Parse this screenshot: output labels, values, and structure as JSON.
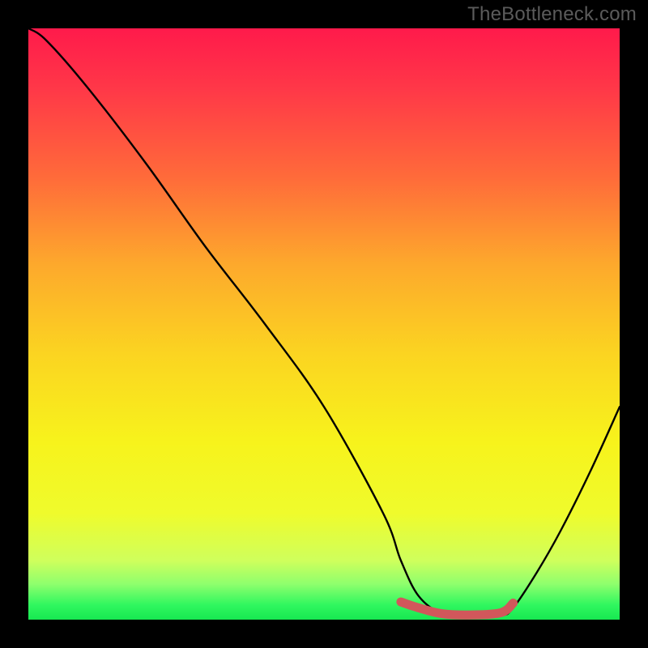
{
  "watermark": "TheBottleneck.com",
  "chart_data": {
    "type": "line",
    "title": "",
    "xlabel": "",
    "ylabel": "",
    "xlim": [
      0,
      100
    ],
    "ylim": [
      0,
      100
    ],
    "series": [
      {
        "name": "bottleneck-curve",
        "x": [
          0,
          3,
          10,
          20,
          30,
          40,
          50,
          60,
          63,
          66,
          70,
          75,
          80,
          82,
          86,
          90,
          95,
          100
        ],
        "values": [
          100,
          98,
          90,
          77,
          63,
          50,
          36,
          18,
          10,
          4,
          1,
          0.5,
          0.7,
          2,
          8,
          15,
          25,
          36
        ]
      }
    ],
    "highlight": {
      "name": "minimum-band",
      "x": [
        63,
        66,
        70,
        75,
        80,
        82
      ],
      "values": [
        3,
        2,
        1,
        0.8,
        1.2,
        2.8
      ],
      "color": "#d1575b"
    },
    "gradient_stops": [
      {
        "offset": 0.0,
        "color": "#FF1A4B"
      },
      {
        "offset": 0.1,
        "color": "#FF3748"
      },
      {
        "offset": 0.25,
        "color": "#FF6A3A"
      },
      {
        "offset": 0.4,
        "color": "#FDA92C"
      },
      {
        "offset": 0.55,
        "color": "#FBD421"
      },
      {
        "offset": 0.7,
        "color": "#F7F31C"
      },
      {
        "offset": 0.82,
        "color": "#EFFB2C"
      },
      {
        "offset": 0.9,
        "color": "#CFFF5C"
      },
      {
        "offset": 0.94,
        "color": "#8EFF6D"
      },
      {
        "offset": 0.975,
        "color": "#30F75F"
      },
      {
        "offset": 1.0,
        "color": "#17E851"
      }
    ]
  }
}
